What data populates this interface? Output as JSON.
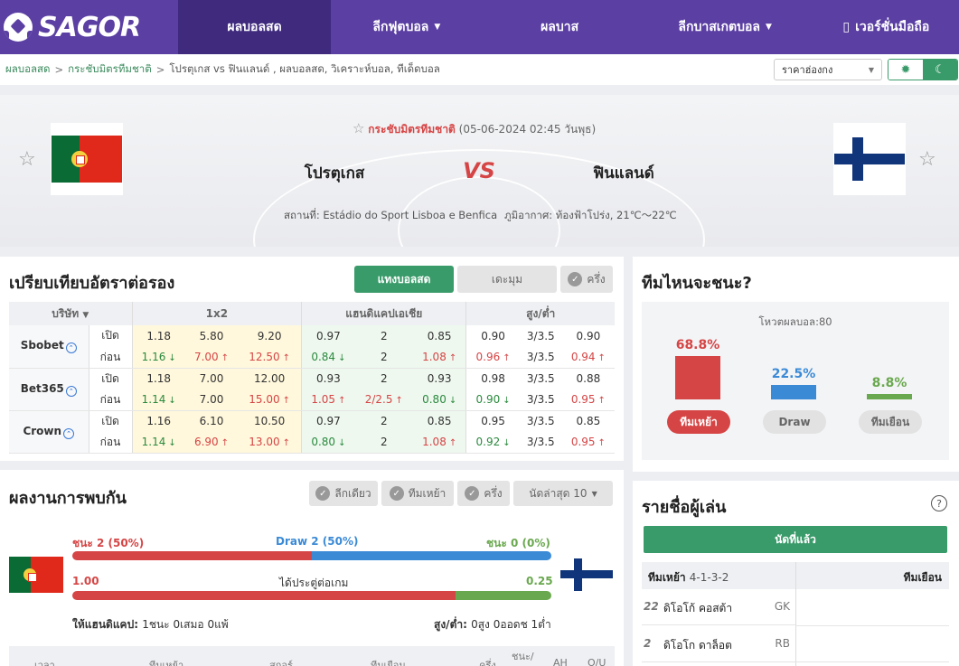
{
  "nav": {
    "logo": "SAGOR",
    "items": [
      {
        "label": "ผลบอลสด",
        "active": true
      },
      {
        "label": "ลีกฟุตบอล",
        "dropdown": true
      },
      {
        "label": "ผลบาส"
      },
      {
        "label": "ลีกบาสเกตบอล",
        "dropdown": true
      },
      {
        "label": "เวอร์ชั่นมือถือ"
      }
    ]
  },
  "breadcrumb": {
    "home": "ผลบอลสด",
    "league": "กระชับมิตรทีมชาติ",
    "current": "โปรตุเกส vs ฟินแลนด์ , ผลบอลสด, วิเคราะห์บอล, ทีเด็ดบอล",
    "sep": ">"
  },
  "odds_format": "ราคาฮ่องกง",
  "match": {
    "competition": "กระชับมิตรทีมชาติ",
    "datetime": "(05-06-2024 02:45 วันพุธ)",
    "home": "โปรตุเกส",
    "vs": "VS",
    "away": "ฟินแลนด์",
    "venue": "สถานที่: Estádio do Sport Lisboa e Benfica",
    "weather": "ภูมิอากาศ: ท้องฟ้าโปร่ง, 21℃～22℃"
  },
  "odds": {
    "title": "เปรียบเทียบอัตราต่อรอง",
    "btn_live": "แทงบอลสด",
    "btn_more": "เดะมุม",
    "btn_half": "ครึ่ง",
    "col_company": "บริษัท",
    "col_1x2": "1x2",
    "col_hdp": "แฮนดิแคปเอเชีย",
    "col_ou": "สูง/ต่ำ",
    "open_label": "เปิด",
    "before_label": "ก่อน",
    "books": [
      {
        "name": "Sbobet",
        "open": [
          "1.18",
          "5.80",
          "9.20",
          "0.97",
          "2",
          "0.85",
          "0.90",
          "3/3.5",
          "0.90"
        ],
        "open_dir": [
          "",
          "",
          "",
          "",
          "",
          "",
          "",
          "",
          ""
        ],
        "before": [
          "1.16",
          "7.00",
          "12.50",
          "0.84",
          "2",
          "1.08",
          "0.96",
          "3/3.5",
          "0.94"
        ],
        "before_dir": [
          "dn",
          "up",
          "up",
          "dn",
          "",
          "up",
          "up",
          "",
          "up"
        ]
      },
      {
        "name": "Bet365",
        "open": [
          "1.18",
          "7.00",
          "12.00",
          "0.93",
          "2",
          "0.93",
          "0.98",
          "3/3.5",
          "0.88"
        ],
        "open_dir": [
          "",
          "",
          "",
          "",
          "",
          "",
          "",
          "",
          ""
        ],
        "before": [
          "1.14",
          "7.00",
          "15.00",
          "1.05",
          "2/2.5",
          "0.80",
          "0.90",
          "3/3.5",
          "0.95"
        ],
        "before_dir": [
          "dn",
          "",
          "up",
          "up",
          "up",
          "dn",
          "dn",
          "",
          "up"
        ]
      },
      {
        "name": "Crown",
        "open": [
          "1.16",
          "6.10",
          "10.50",
          "0.97",
          "2",
          "0.85",
          "0.95",
          "3/3.5",
          "0.85"
        ],
        "open_dir": [
          "",
          "",
          "",
          "",
          "",
          "",
          "",
          "",
          ""
        ],
        "before": [
          "1.14",
          "6.90",
          "13.00",
          "0.80",
          "2",
          "1.08",
          "0.92",
          "3/3.5",
          "0.95"
        ],
        "before_dir": [
          "dn",
          "up",
          "up",
          "dn",
          "",
          "up",
          "dn",
          "",
          "up"
        ]
      }
    ]
  },
  "winner": {
    "title": "ทีมไหนจะชนะ?",
    "votes": "โหวตผลบอล:80",
    "home_pct": "68.8%",
    "draw_pct": "22.5%",
    "away_pct": "8.8%",
    "home_value": 68.8,
    "draw_value": 22.5,
    "away_value": 8.8,
    "home_btn": "ทีมเหย้า",
    "draw_btn": "Draw",
    "away_btn": "ทีมเยือน"
  },
  "h2h": {
    "title": "ผลงานการพบกัน",
    "chip_league": "ลีกเดียว",
    "chip_home": "ทีมเหย้า",
    "chip_half": "ครึ่ง",
    "chip_last": "นัดล่าสุด 10",
    "win_home": "ชนะ 2 (50%)",
    "draw": "Draw 2 (50%)",
    "win_away": "ชนะ 0 (0%)",
    "win_home_value": 50,
    "draw_value": 50,
    "goals_home": "1.00",
    "goals_label": "ได้ประตู่ต่อเกม",
    "goals_away": "0.25",
    "goals_home_value": 1.0,
    "goals_away_value": 0.25,
    "hdp_label": "ให้แฮนดิแคป:",
    "hdp_value": "1ชนะ 0เสมอ 0แพ้",
    "ou_label": "สูง/ต่ำ:",
    "ou_value": "0สูง 0ออดช 1ต่ำ",
    "cols": [
      "เวลา",
      "ทีมเหย้า",
      "สกอร์",
      "ทีมเยือน",
      "ครึ่ง",
      "ชนะ/",
      "AH",
      "O/U"
    ]
  },
  "players": {
    "title": "รายชื่อผู้เล่น",
    "help": "?",
    "btn": "นัดที่แล้ว",
    "home_tab": "ทีมเหย้า",
    "formation": "4-1-3-2",
    "away_tab": "ทีมเยือน",
    "list": [
      {
        "num": "22",
        "name": "ดิโอโก้ คอสต้า",
        "pos": "GK"
      },
      {
        "num": "2",
        "name": "ดิโอโก ดาล็อต",
        "pos": "RB"
      }
    ]
  },
  "colors": {
    "brand": "#5b3fa3",
    "accent": "#3a9b6a",
    "home": "#d64545",
    "draw": "#3a8ad6",
    "away": "#6aa84f"
  }
}
